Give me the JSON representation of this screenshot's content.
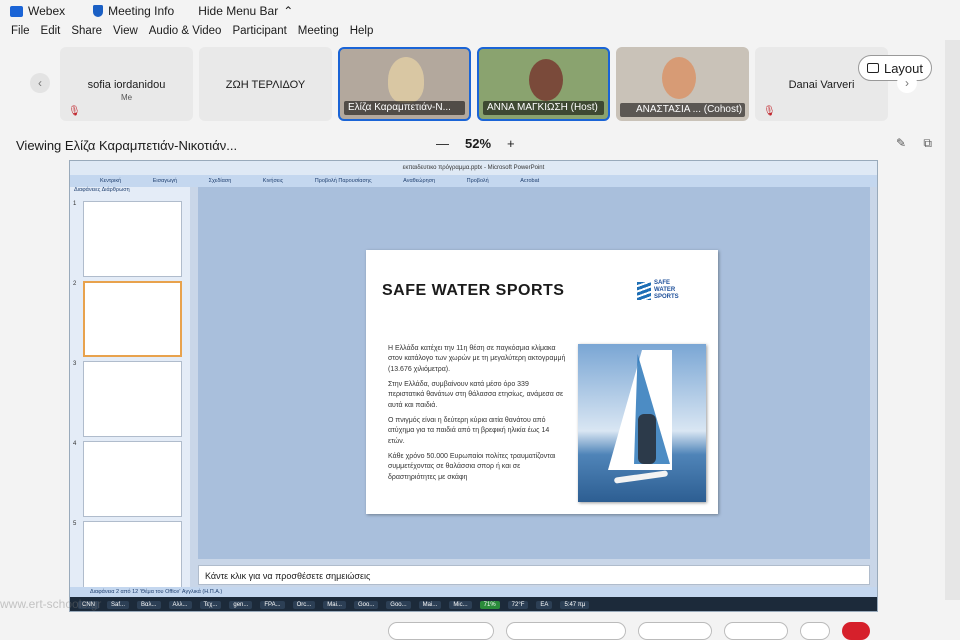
{
  "topbar": {
    "app_name": "Webex",
    "meeting_info": "Meeting Info",
    "hide_menu_bar": "Hide Menu Bar",
    "chevron": "⌃"
  },
  "menu": {
    "items": [
      "File",
      "Edit",
      "Share",
      "View",
      "Audio & Video",
      "Participant",
      "Meeting",
      "Help"
    ]
  },
  "participants": [
    {
      "name": "sofia iordanidou",
      "sub": "Me",
      "type": "avatar",
      "muted": true
    },
    {
      "name": "ΖΩΗ ΤΕΡΛΙΔΟΥ",
      "sub": "",
      "type": "avatar",
      "muted": false
    },
    {
      "name": "Ελίζα Καραμπετιάν-Ν...",
      "sub": "",
      "type": "video",
      "muted": false
    },
    {
      "name": "ΑΝΝΑ ΜΑΓΚΙΩΣΗ (Host)",
      "sub": "",
      "type": "video",
      "muted": false
    },
    {
      "name": "ΑΝΑΣΤΑΣΙΑ ... (Cohost)",
      "sub": "",
      "type": "video",
      "muted": true
    },
    {
      "name": "Danai Varveri",
      "sub": "",
      "type": "avatar",
      "muted": true
    }
  ],
  "layout_button": "Layout",
  "viewing_label": "Viewing Ελίζα Καραμπετιάν-Νικοτιάν...",
  "zoom": {
    "minus": "—",
    "value": "52%",
    "plus": "+"
  },
  "powerpoint": {
    "title": "εκπαιδευτικο πρόγραμμα.pptx - Microsoft PowerPoint",
    "ribbon": [
      "Κεντρική",
      "Εισαγωγή",
      "Σχεδίαση",
      "Κινήσεις",
      "Προβολή Παρουσίασης",
      "Αναθεώρηση",
      "Προβολή",
      "Acrobat"
    ],
    "panel_tabs": "Διαφάνειες   Διάρθρωση",
    "thumb_numbers": [
      "1",
      "2",
      "3",
      "4",
      "5"
    ],
    "slide": {
      "title": "SAFE WATER SPORTS",
      "brand_lines": [
        "SAFE",
        "WATER",
        "SPORTS"
      ],
      "bullets": [
        "Η Ελλάδα κατέχει την 11η θέση σε παγκόσμια κλίμακα στον κατάλογο των χωρών με τη μεγαλύτερη ακτογραμμή (13.676 χιλιόμετρα).",
        "Στην Ελλάδα, συμβαίνουν κατά μέσο όρο 339 περιστατικά θανάτων στη θάλασσα ετησίως, ανάμεσα σε αυτά και παιδιά.",
        "Ο πνιγμός είναι η δεύτερη κύρια αιτία θανάτου από ατύχημα για τα παιδιά από τη βρεφική ηλικία έως 14 ετών.",
        "Κάθε χρόνο 50.000 Ευρωπαίοι πολίτες τραυματίζονται συμμετέχοντας σε θαλάσσια σπορ ή και σε δραστηριότητες με σκάφη"
      ]
    },
    "notes_placeholder": "Κάντε κλικ για να προσθέσετε σημειώσεις",
    "status": "Διαφάνεια 2 από 12    'Θέμα του Office'    Αγγλικά (Η.Π.Α.)",
    "taskbar": [
      "CNN",
      "Saf...",
      "Βαλ...",
      "Αλλ...",
      "Τεχ...",
      "gen...",
      "FPA...",
      "Orc...",
      "Mai...",
      "Goo...",
      "Goo...",
      "Mai...",
      "Mic...",
      "71%",
      "72°F",
      "EA",
      "5:47 πμ"
    ]
  },
  "watermark": "www.ert-schools.gr"
}
